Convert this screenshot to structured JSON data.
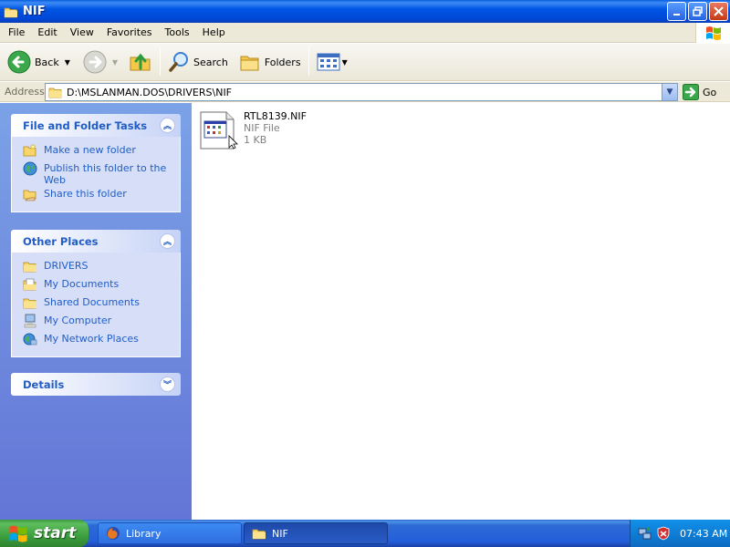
{
  "window": {
    "title": "NIF"
  },
  "menu": [
    "File",
    "Edit",
    "View",
    "Favorites",
    "Tools",
    "Help"
  ],
  "toolbar": {
    "back_label": "Back",
    "search_label": "Search",
    "folders_label": "Folders"
  },
  "address": {
    "label": "Address",
    "path": "D:\\MSLANMAN.DOS\\DRIVERS\\NIF",
    "go_label": "Go"
  },
  "sidebar": {
    "file_tasks": {
      "title": "File and Folder Tasks",
      "items": [
        {
          "label": "Make a new folder",
          "icon": "new-folder-icon"
        },
        {
          "label": "Publish this folder to the Web",
          "icon": "globe-icon"
        },
        {
          "label": "Share this folder",
          "icon": "share-folder-icon"
        }
      ]
    },
    "other_places": {
      "title": "Other Places",
      "items": [
        {
          "label": "DRIVERS",
          "icon": "folder-icon"
        },
        {
          "label": "My Documents",
          "icon": "documents-icon"
        },
        {
          "label": "Shared Documents",
          "icon": "folder-icon"
        },
        {
          "label": "My Computer",
          "icon": "computer-icon"
        },
        {
          "label": "My Network Places",
          "icon": "network-icon"
        }
      ]
    },
    "details": {
      "title": "Details"
    }
  },
  "files": [
    {
      "name": "RTL8139.NIF",
      "type": "NIF File",
      "size": "1 KB"
    }
  ],
  "taskbar": {
    "start_label": "start",
    "tasks": [
      {
        "label": "Library",
        "active": false
      },
      {
        "label": "NIF",
        "active": true
      }
    ],
    "clock": "07:43 AM"
  },
  "colors": {
    "title_blue": "#0054e3",
    "taskpane_blue": "#7ba2e7",
    "link_blue": "#215dc6",
    "start_green": "#3d9f3d"
  }
}
